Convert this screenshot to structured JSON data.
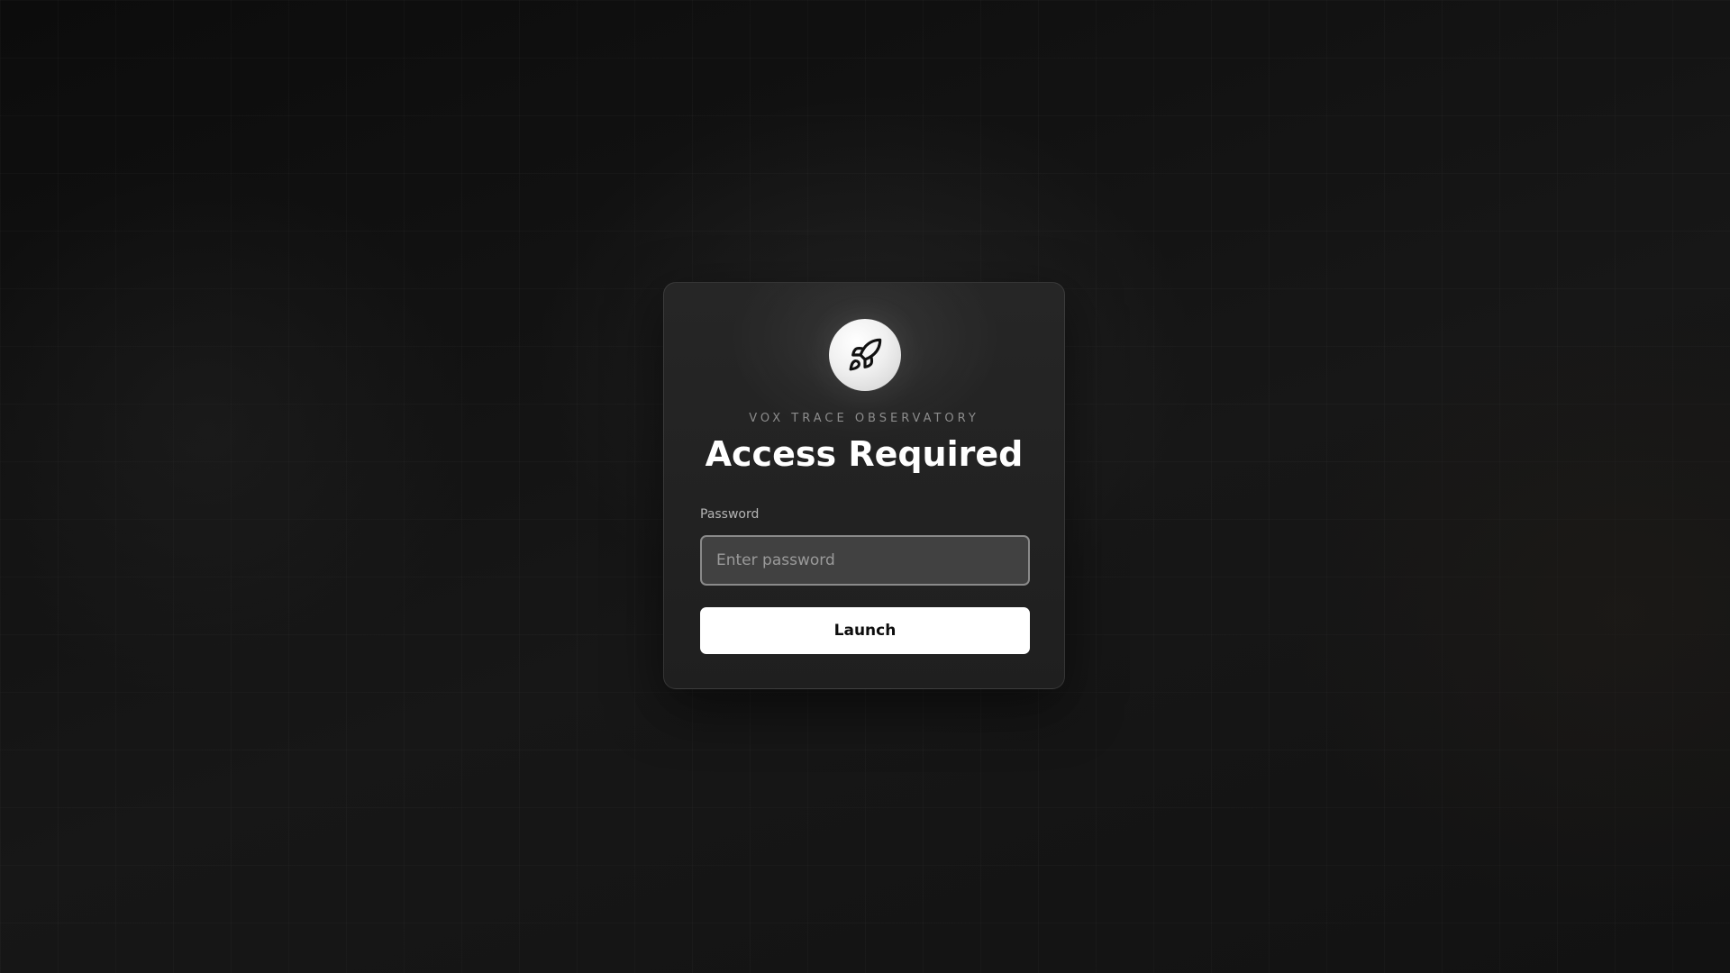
{
  "login": {
    "logo_icon": "rocket-icon",
    "brand": "VOX TRACE OBSERVATORY",
    "title": "Access Required",
    "password_label": "Password",
    "password_value": "",
    "password_placeholder": "Enter password",
    "submit_label": "Launch"
  },
  "colors": {
    "background": "#121212",
    "card": "#242424",
    "accent": "#ffffff",
    "input_background": "#414141",
    "input_border": "#8a8a8a"
  }
}
